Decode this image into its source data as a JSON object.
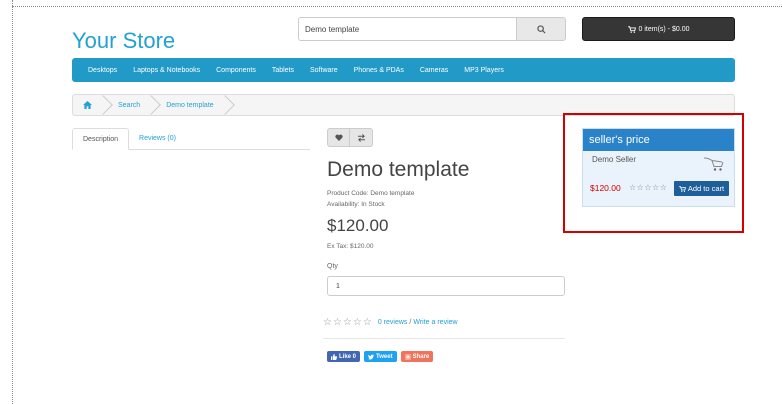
{
  "header": {
    "logo": "Your Store",
    "search": {
      "value": "Demo template"
    },
    "cart_label": "0 item(s) - $0.00"
  },
  "menu": [
    "Desktops",
    "Laptops & Notebooks",
    "Components",
    "Tablets",
    "Software",
    "Phones & PDAs",
    "Cameras",
    "MP3 Players"
  ],
  "breadcrumb": {
    "search": "Search",
    "current": "Demo template"
  },
  "tabs": {
    "description": "Description",
    "reviews": "Reviews (0)"
  },
  "product": {
    "title": "Demo template",
    "code": "Product Code: Demo template",
    "availability": "Availability: In Stock",
    "price": "$120.00",
    "ex_tax": "Ex Tax: $120.00",
    "qty_label": "Qty",
    "qty_value": "1",
    "stars": "☆☆☆☆☆",
    "reviews_link": "0 reviews",
    "write_review": "Write a review"
  },
  "social": {
    "like": "Like 0",
    "tweet": "Tweet",
    "share": "Share"
  },
  "seller_box": {
    "heading": "seller's price",
    "seller_name": "Demo Seller",
    "price": "$120.00",
    "stars": "☆☆☆☆☆",
    "add_to_cart": "Add to cart"
  },
  "colors": {
    "brand": "#23a1d1",
    "menu": "#229ac8",
    "seller_header": "#2a82c9",
    "price_red": "#cc0000",
    "highlight": "#d40000"
  }
}
